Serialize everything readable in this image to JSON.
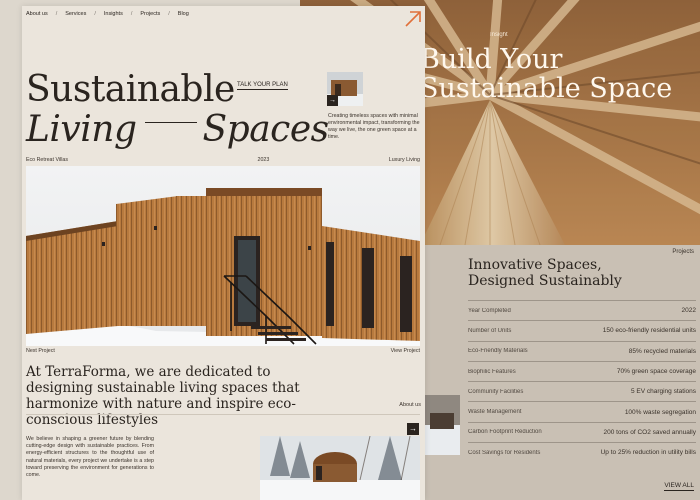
{
  "nav": {
    "items": [
      "About us",
      "Services",
      "Insights",
      "Projects",
      "Blog"
    ],
    "separator": "/"
  },
  "hero": {
    "title_line1": "Sustainable",
    "title_line2_a": "Living",
    "title_line2_b": "Spaces",
    "cta": "TALK YOUR PLAN",
    "description": "Creating timeless spaces with minimal environmental impact, transforming the way we live, the one green space at a time."
  },
  "project_meta": {
    "left": "Eco Retreat Villas",
    "middle": "2023",
    "right": "Luxury Living"
  },
  "image_meta": {
    "left": "Next Project",
    "right": "View Project"
  },
  "mission": {
    "text": "At TerraForma, we are dedicated to designing sustainable living spaces that harmonize with nature and inspire eco-conscious lifestyles",
    "about_link": "About us",
    "body": "We believe in shaping a greener future by blending cutting-edge design with sustainable practices. From energy-efficient structures to the thoughtful use of natural materials, every project we undertake is a step toward preserving the environment for generations to come."
  },
  "back_card": {
    "label": "Insight",
    "title_line1": "Build Your",
    "title_line2": "Sustainable Space",
    "projects_label": "Projects",
    "heading_line1": "Innovative Spaces,",
    "heading_line2": "Designed Sustainably",
    "specs": [
      {
        "label": "Year Completed",
        "value": "2022"
      },
      {
        "label": "Number of Units",
        "value": "150 eco-friendly residential units"
      },
      {
        "label": "Eco-Friendly Materials",
        "value": "85% recycled materials"
      },
      {
        "label": "Biophilic Features",
        "value": "70% green space coverage"
      },
      {
        "label": "Community Facilities",
        "value": "5 EV charging stations"
      },
      {
        "label": "Waste Management",
        "value": "100% waste segregation"
      },
      {
        "label": "Carbon Footprint Reduction",
        "value": "200 tons of CO2 saved annually"
      },
      {
        "label": "Cost Savings for Residents",
        "value": "Up to 25% reduction in utility bills"
      }
    ],
    "view_all": "VIEW ALL"
  },
  "colors": {
    "accent": "#e0703a",
    "ink": "#2a241f",
    "paper": "#ebe5dc",
    "wood": "#b87a3e"
  },
  "icons": {
    "corner": "arrow-up-right-icon",
    "thumb": "arrow-right-icon",
    "bottom": "arrow-right-icon"
  }
}
